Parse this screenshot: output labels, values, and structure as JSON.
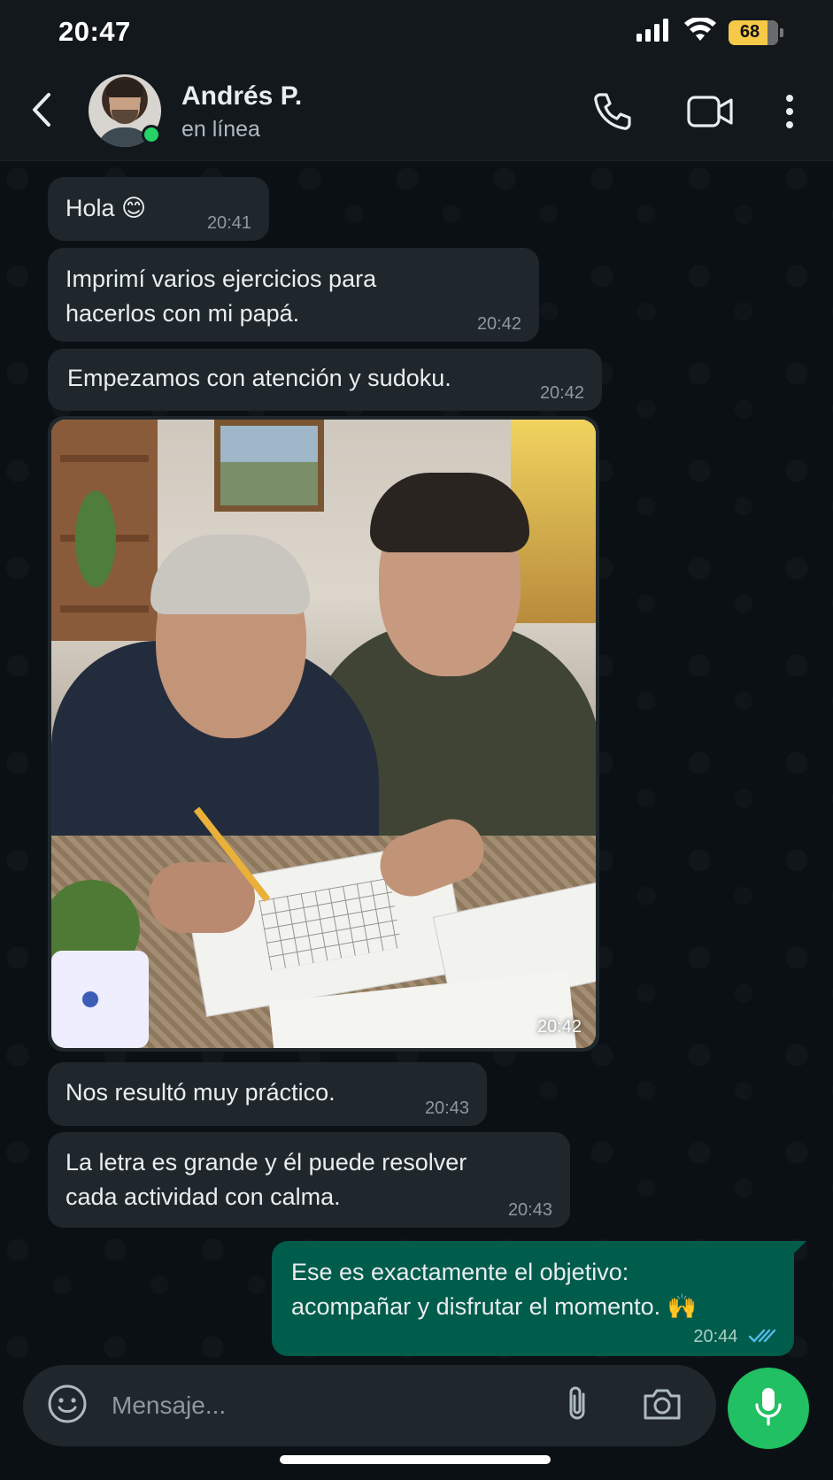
{
  "status_bar": {
    "time": "20:47",
    "battery": "68",
    "icons": [
      "signal-icon",
      "wifi-icon",
      "battery-icon"
    ]
  },
  "header": {
    "contact_name": "Andrés P.",
    "contact_status": "en línea",
    "icons": [
      "back-icon",
      "phone-icon",
      "video-icon",
      "more-icon"
    ]
  },
  "messages": [
    {
      "direction": "in",
      "text": "Hola 😊",
      "time": "20:41"
    },
    {
      "direction": "in",
      "text": "Imprimí varios ejercicios para\nhacerlos con mi papá.",
      "time": "20:42"
    },
    {
      "direction": "in",
      "text": "Empezamos con atención y sudoku.",
      "time": "20:42"
    },
    {
      "direction": "in",
      "type": "photo",
      "time": "20:42"
    },
    {
      "direction": "in",
      "text": "Nos resultó muy práctico.",
      "time": "20:43"
    },
    {
      "direction": "in",
      "text": "La letra es grande y él puede resolver\ncada actividad con calma.",
      "time": "20:43"
    },
    {
      "direction": "out",
      "text": "Ese es exactamente el objetivo:\nacompañar y disfrutar el momento. 🙌",
      "time": "20:44",
      "status": "read"
    }
  ],
  "composer": {
    "placeholder": "Mensaje...",
    "icons": [
      "emoji-icon",
      "attach-icon",
      "camera-icon",
      "mic-icon"
    ]
  },
  "colors": {
    "background": "#0b1014",
    "incoming_bubble": "#1f272c",
    "outgoing_bubble": "#005c4b",
    "accent": "#21c063",
    "read_ticks": "#53bdeb"
  }
}
